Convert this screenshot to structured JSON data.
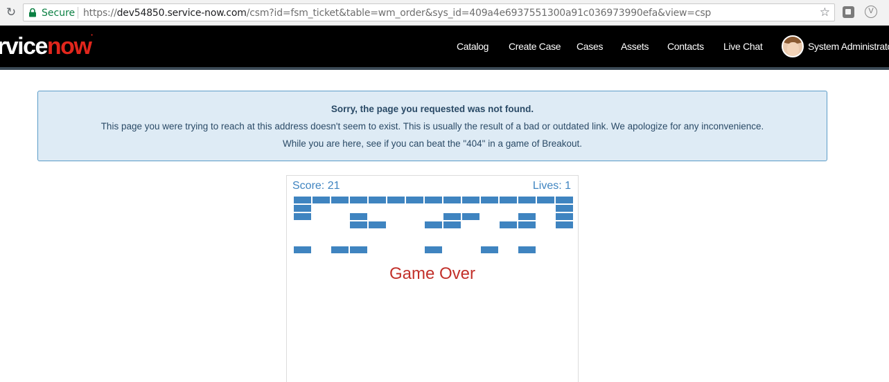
{
  "browser": {
    "secure_label": "Secure",
    "url_scheme": "https://",
    "url_host": "dev54850.service-now.com",
    "url_path": "/csm?id=fsm_ticket&table=wm_order&sys_id=409a4e6937551300a91c036973990efa&view=csp",
    "icons": [
      "reload-icon",
      "lock-icon",
      "star-icon",
      "extension-icon",
      "vivaldi-icon"
    ]
  },
  "header": {
    "logo_service": "rvice",
    "logo_now": "now",
    "nav": [
      {
        "label": "Catalog"
      },
      {
        "label": "Create Case"
      },
      {
        "label": "Cases"
      },
      {
        "label": "Assets"
      },
      {
        "label": "Contacts"
      },
      {
        "label": "Live Chat"
      }
    ],
    "user_name": "System Administrator"
  },
  "alert": {
    "title": "Sorry, the page you requested was not found.",
    "line1": "This page you were trying to reach at this address doesn't seem to exist. This is usually the result of a bad or outdated link. We apologize for any inconvenience.",
    "line2": "While you are here, see if you can beat the \"404\" in a game of Breakout."
  },
  "game": {
    "score_label": "Score: 21",
    "lives_label": "Lives: 1",
    "game_over": "Game Over",
    "brick_color": "#3f84c0",
    "bricks": [
      "111111111111111",
      "100000000000001",
      "100100001100101",
      "000110011001101",
      "000000000000000",
      "000000000000000",
      "101100010010100"
    ]
  },
  "colors": {
    "header_bg": "#000000",
    "accent_red": "#e1261c",
    "alert_bg": "#deebf5",
    "alert_border": "#5a9bc7",
    "game_over": "#c2302a"
  }
}
